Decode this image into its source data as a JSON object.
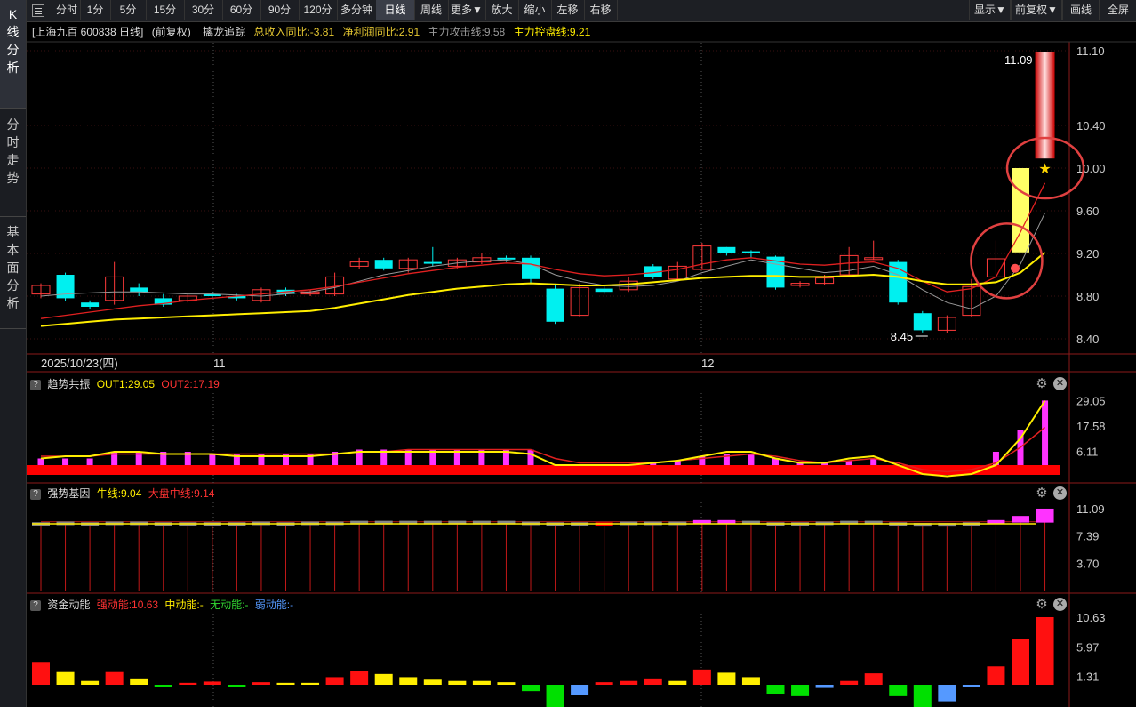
{
  "sidebar": [
    {
      "label": "K线分析",
      "chars": [
        "K",
        "线",
        "分",
        "析"
      ],
      "active": true
    },
    {
      "label": "分时走势",
      "chars": [
        "分",
        "时",
        "走",
        "势"
      ],
      "active": false
    },
    {
      "label": "基本面分析",
      "chars": [
        "基",
        "本",
        "面",
        "分",
        "析"
      ],
      "active": false
    }
  ],
  "toolbar": {
    "items": [
      "分时",
      "1分",
      "5分",
      "15分",
      "30分",
      "60分",
      "90分",
      "120分",
      "多分钟",
      "日线",
      "周线",
      "更多▼",
      "放大",
      "缩小",
      "左移",
      "右移"
    ],
    "active": "日线",
    "right_items": [
      "显示▼",
      "前复权▼",
      "画线",
      "全屏"
    ]
  },
  "info": {
    "title": "[上海九百 600838 日线]",
    "adjust": "(前复权)",
    "indicator": "擒龙追踪",
    "revenue_label": "总收入同比:-3.81",
    "profit_label": "净利润同比:2.91",
    "attack_label": "主力攻击线:9.58",
    "control_label": "主力控盘线:9.21"
  },
  "colors": {
    "up": "#ff3a3a",
    "down": "#00f0f0",
    "ma_yellow": "#ffee00",
    "ma_red": "#e02020",
    "magenta": "#ff33ff",
    "green": "#00e000",
    "blue": "#5599ff"
  },
  "main_chart": {
    "y_ticks": [
      "11.10",
      "10.40",
      "10.00",
      "9.60",
      "9.20",
      "8.80",
      "8.40"
    ],
    "high_label": "11.09",
    "low_label": "8.45",
    "dates": [
      "2025/10/23(四)",
      "11",
      "12"
    ],
    "candles": [
      [
        8.82,
        8.9,
        8.78,
        8.92
      ],
      [
        9.0,
        8.78,
        8.75,
        9.02
      ],
      [
        8.74,
        8.7,
        8.68,
        8.76
      ],
      [
        8.76,
        8.98,
        8.72,
        9.12
      ],
      [
        8.88,
        8.84,
        8.8,
        8.92
      ],
      [
        8.78,
        8.72,
        8.7,
        8.82
      ],
      [
        8.76,
        8.8,
        8.74,
        8.82
      ],
      [
        8.82,
        8.8,
        8.78,
        8.84
      ],
      [
        8.8,
        8.78,
        8.76,
        8.82
      ],
      [
        8.76,
        8.86,
        8.74,
        8.88
      ],
      [
        8.86,
        8.82,
        8.8,
        8.88
      ],
      [
        8.82,
        8.84,
        8.8,
        8.86
      ],
      [
        8.82,
        8.98,
        8.8,
        9.02
      ],
      [
        9.08,
        9.12,
        9.05,
        9.16
      ],
      [
        9.14,
        9.06,
        9.04,
        9.16
      ],
      [
        9.06,
        9.14,
        9.02,
        9.16
      ],
      [
        9.12,
        9.11,
        9.08,
        9.26
      ],
      [
        9.08,
        9.14,
        9.06,
        9.16
      ],
      [
        9.12,
        9.16,
        9.1,
        9.2
      ],
      [
        9.16,
        9.15,
        9.12,
        9.18
      ],
      [
        9.16,
        8.96,
        8.92,
        9.18
      ],
      [
        8.87,
        8.56,
        8.54,
        8.9
      ],
      [
        8.62,
        8.88,
        8.6,
        8.92
      ],
      [
        8.87,
        8.84,
        8.82,
        8.9
      ],
      [
        8.86,
        8.94,
        8.84,
        8.98
      ],
      [
        9.08,
        8.98,
        8.96,
        9.1
      ],
      [
        8.96,
        9.08,
        8.94,
        9.12
      ],
      [
        9.05,
        9.27,
        9.05,
        9.3
      ],
      [
        9.26,
        9.2,
        9.18,
        9.26
      ],
      [
        9.22,
        9.21,
        9.16,
        9.23
      ],
      [
        9.17,
        8.88,
        8.86,
        9.18
      ],
      [
        8.9,
        8.92,
        8.88,
        8.94
      ],
      [
        8.92,
        8.97,
        8.9,
        9.0
      ],
      [
        9.0,
        9.18,
        8.98,
        9.26
      ],
      [
        9.16,
        9.16,
        9.14,
        9.32
      ],
      [
        9.12,
        8.74,
        8.72,
        9.14
      ],
      [
        8.64,
        8.48,
        8.46,
        8.66
      ],
      [
        8.48,
        8.6,
        8.45,
        8.62
      ],
      [
        8.62,
        8.89,
        8.6,
        8.96
      ],
      [
        8.98,
        9.15,
        8.98,
        9.32
      ],
      [
        9.21,
        10.1,
        9.18,
        10.1
      ],
      [
        10.11,
        11.09,
        10.09,
        11.12
      ]
    ],
    "ma_red": [
      8.59,
      8.62,
      8.65,
      8.68,
      8.71,
      8.73,
      8.76,
      8.78,
      8.8,
      8.82,
      8.84,
      8.86,
      8.89,
      8.93,
      8.97,
      9.01,
      9.04,
      9.07,
      9.09,
      9.11,
      9.1,
      9.05,
      9.01,
      8.99,
      9.0,
      9.02,
      9.05,
      9.1,
      9.14,
      9.16,
      9.13,
      9.1,
      9.09,
      9.11,
      9.12,
      9.06,
      8.94,
      8.84,
      8.87,
      8.98,
      9.4,
      9.86
    ],
    "ma_yellow": [
      8.52,
      8.54,
      8.56,
      8.58,
      8.59,
      8.6,
      8.61,
      8.62,
      8.63,
      8.64,
      8.65,
      8.66,
      8.69,
      8.73,
      8.77,
      8.81,
      8.84,
      8.87,
      8.89,
      8.91,
      8.92,
      8.91,
      8.9,
      8.9,
      8.91,
      8.93,
      8.95,
      8.97,
      8.98,
      8.99,
      8.99,
      8.98,
      8.98,
      8.99,
      9.0,
      8.98,
      8.94,
      8.91,
      8.91,
      8.93,
      9.02,
      9.21
    ],
    "ma_gray": [
      8.8,
      8.82,
      8.83,
      8.84,
      8.84,
      8.83,
      8.82,
      8.82,
      8.81,
      8.8,
      8.82,
      8.84,
      8.88,
      8.94,
      9.0,
      9.04,
      9.08,
      9.11,
      9.13,
      9.14,
      9.1,
      9.0,
      8.94,
      8.9,
      8.89,
      8.9,
      8.94,
      9.02,
      9.08,
      9.14,
      9.1,
      9.06,
      9.02,
      9.04,
      9.08,
      9.0,
      8.86,
      8.74,
      8.68,
      8.8,
      9.1,
      9.58
    ]
  },
  "panel1": {
    "name": "趋势共振",
    "out1_label": "OUT1:29.05",
    "out2_label": "OUT2:17.19",
    "y_ticks": [
      "29.05",
      "17.58",
      "6.11"
    ],
    "bars": [
      3,
      3,
      3,
      6,
      6,
      6,
      6,
      5,
      5,
      5,
      5,
      5,
      6,
      7,
      7,
      7,
      7,
      7,
      7,
      7,
      7,
      0,
      0,
      0,
      0,
      1,
      2,
      4,
      5,
      5,
      3,
      1,
      1,
      2,
      3,
      0,
      0,
      0,
      0,
      6,
      16,
      29.05
    ],
    "line_yellow": [
      3,
      4,
      4,
      6,
      6,
      5,
      5,
      5,
      4,
      4,
      4,
      4,
      5,
      6,
      6,
      6,
      6,
      6,
      6,
      6,
      5,
      0,
      0,
      0,
      0,
      1,
      2,
      4,
      6,
      6,
      3,
      1,
      1,
      3,
      4,
      0,
      -4,
      -5,
      -4,
      0,
      12,
      29
    ],
    "line_red": [
      4,
      4,
      4,
      5,
      5,
      5,
      5,
      5,
      5,
      5,
      5,
      5,
      5,
      6,
      6,
      7,
      7,
      7,
      7,
      7,
      7,
      3,
      1,
      1,
      1,
      1,
      2,
      3,
      4,
      5,
      4,
      2,
      1,
      2,
      3,
      1,
      -2,
      -3,
      -2,
      1,
      8,
      17
    ]
  },
  "panel2": {
    "name": "强势基因",
    "bull_label": "牛线:9.04",
    "market_label": "大盘中线:9.14",
    "y_ticks": [
      "11.09",
      "7.39",
      "3.70"
    ],
    "bars": [
      9.0,
      9.1,
      9.0,
      9.1,
      9.1,
      9.0,
      9.0,
      9.0,
      9.0,
      9.1,
      9.0,
      9.1,
      9.1,
      9.2,
      9.2,
      9.2,
      9.2,
      9.2,
      9.2,
      9.2,
      9.1,
      9.0,
      9.0,
      9.0,
      9.1,
      9.1,
      9.1,
      9.3,
      9.3,
      9.2,
      9.0,
      9.0,
      9.1,
      9.2,
      9.2,
      9.0,
      8.9,
      8.9,
      9.0,
      9.3,
      10.1,
      11.09
    ]
  },
  "panel3": {
    "name": "资金动能",
    "strong_label": "强动能:10.63",
    "mid_label": "中动能:-",
    "none_label": "无动能:-",
    "weak_label": "弱动能:-",
    "y_ticks": [
      "10.63",
      "5.97",
      "1.31"
    ],
    "bars": [
      [
        3.6,
        "r"
      ],
      [
        2.0,
        "y"
      ],
      [
        0.6,
        "y"
      ],
      [
        2.0,
        "r"
      ],
      [
        1.0,
        "y"
      ],
      [
        -0.3,
        "g"
      ],
      [
        0.3,
        "r"
      ],
      [
        0.5,
        "r"
      ],
      [
        -0.1,
        "g"
      ],
      [
        0.4,
        "r"
      ],
      [
        0.3,
        "y"
      ],
      [
        0.3,
        "y"
      ],
      [
        1.2,
        "r"
      ],
      [
        2.2,
        "r"
      ],
      [
        1.7,
        "y"
      ],
      [
        1.2,
        "y"
      ],
      [
        0.8,
        "y"
      ],
      [
        0.6,
        "y"
      ],
      [
        0.6,
        "y"
      ],
      [
        0.4,
        "y"
      ],
      [
        -1.0,
        "g"
      ],
      [
        -3.8,
        "g"
      ],
      [
        -1.6,
        "b"
      ],
      [
        0.4,
        "r"
      ],
      [
        0.6,
        "r"
      ],
      [
        1.0,
        "r"
      ],
      [
        0.6,
        "y"
      ],
      [
        2.4,
        "r"
      ],
      [
        1.9,
        "y"
      ],
      [
        1.2,
        "y"
      ],
      [
        -1.4,
        "g"
      ],
      [
        -1.8,
        "g"
      ],
      [
        -0.5,
        "b"
      ],
      [
        0.6,
        "r"
      ],
      [
        1.8,
        "r"
      ],
      [
        -1.8,
        "g"
      ],
      [
        -3.8,
        "g"
      ],
      [
        -2.6,
        "b"
      ],
      [
        -0.2,
        "b"
      ],
      [
        2.9,
        "r"
      ],
      [
        7.2,
        "r"
      ],
      [
        10.63,
        "r"
      ]
    ]
  }
}
